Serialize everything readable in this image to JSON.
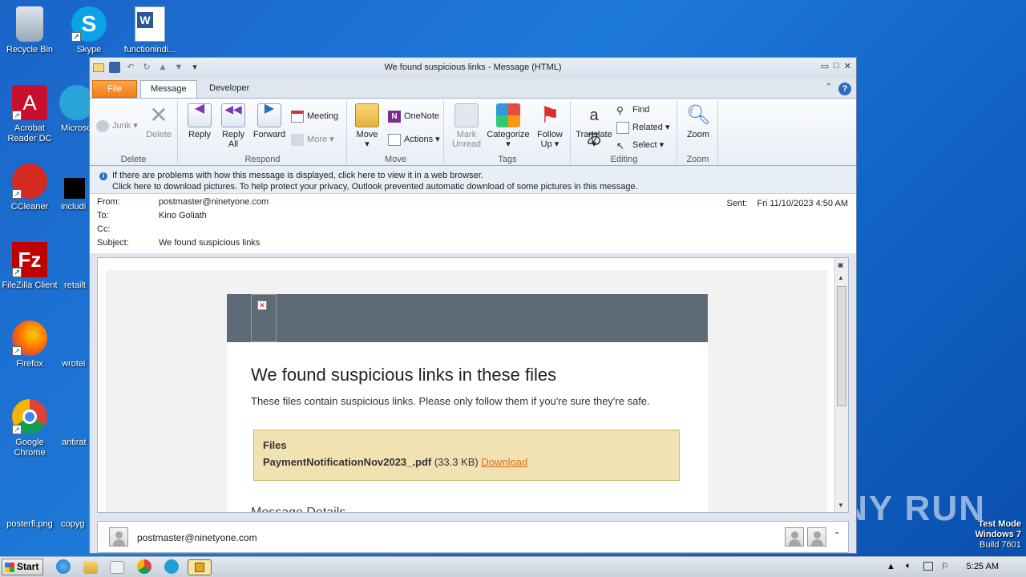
{
  "desktop": {
    "icons": [
      {
        "label": "Recycle Bin"
      },
      {
        "label": "Skype"
      },
      {
        "label": "functionindi..."
      },
      {
        "label": "Acrobat Reader DC"
      },
      {
        "label": "Microso"
      },
      {
        "label": "CCleaner"
      },
      {
        "label": "includi"
      },
      {
        "label": "FileZilla Client"
      },
      {
        "label": "retailt"
      },
      {
        "label": "Firefox"
      },
      {
        "label": "wrotei"
      },
      {
        "label": "Google Chrome"
      },
      {
        "label": "antirat"
      },
      {
        "label": "posterfi.png"
      },
      {
        "label": "copyg"
      }
    ],
    "watermark": "ANY RUN",
    "test_mode": {
      "line1": "Test Mode",
      "line2": "Windows 7",
      "line3": "Build 7601"
    }
  },
  "taskbar": {
    "start_label": "Start",
    "clock": "5:25 AM"
  },
  "window": {
    "title": "We found suspicious links  -  Message (HTML)",
    "tabs": {
      "file": "File",
      "message": "Message",
      "developer": "Developer"
    },
    "ribbon": {
      "delete_group": {
        "label": "Delete",
        "junk": "Junk",
        "delete": "Delete"
      },
      "respond_group": {
        "label": "Respond",
        "reply": "Reply",
        "reply_all_1": "Reply",
        "reply_all_2": "All",
        "forward": "Forward",
        "meeting": "Meeting",
        "more": "More"
      },
      "move_group": {
        "label": "Move",
        "move": "Move",
        "onenote": "OneNote",
        "actions": "Actions"
      },
      "tags_group": {
        "label": "Tags",
        "mark_unread_1": "Mark",
        "mark_unread_2": "Unread",
        "categorize": "Categorize",
        "follow_up_1": "Follow",
        "follow_up_2": "Up"
      },
      "editing_group": {
        "label": "Editing",
        "translate": "Translate",
        "find": "Find",
        "related": "Related",
        "select": "Select"
      },
      "zoom_group": {
        "label": "Zoom",
        "zoom": "Zoom"
      }
    },
    "infobar": {
      "line1": "If there are problems with how this message is displayed, click here to view it in a web browser.",
      "line2": "Click here to download pictures. To help protect your privacy, Outlook prevented automatic download of some pictures in this message."
    },
    "headers": {
      "from_label": "From:",
      "from": "postmaster@ninetyone.com",
      "to_label": "To:",
      "to": "Kino Goliath",
      "cc_label": "Cc:",
      "cc": "",
      "subject_label": "Subject:",
      "subject": "We found suspicious links",
      "sent_label": "Sent:",
      "sent": "Fri 11/10/2023 4:50 AM"
    },
    "email": {
      "heading": "We found suspicious links in these files",
      "intro": "These files contain suspicious links. Please only follow them if you're sure they're safe.",
      "files_heading": "Files",
      "file_name": "PaymentNotificationNov2023_.pdf",
      "file_size": "(33.3 KB)",
      "download": "Download",
      "details_heading": "Message Details"
    },
    "footer": {
      "sender": "postmaster@ninetyone.com"
    }
  }
}
